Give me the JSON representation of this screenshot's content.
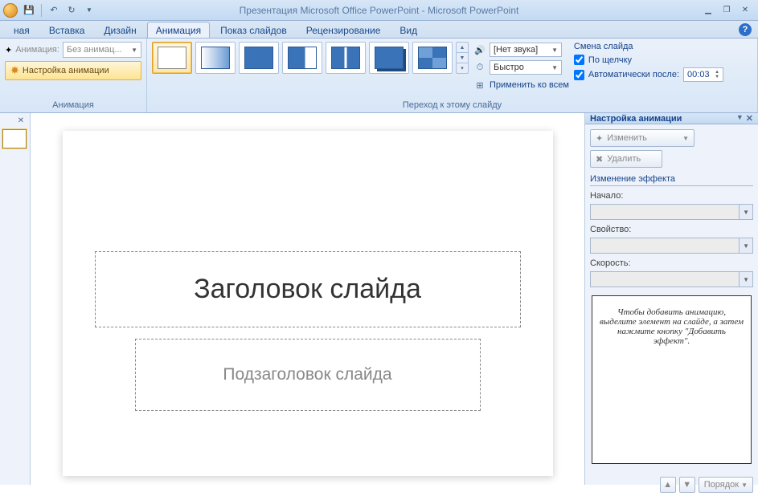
{
  "titlebar": {
    "title": "Презентация Microsoft Office PowerPoint - Microsoft PowerPoint"
  },
  "tabs": {
    "home": "ная",
    "insert": "Вставка",
    "design": "Дизайн",
    "animation": "Анимация",
    "slideshow": "Показ слайдов",
    "review": "Рецензирование",
    "view": "Вид"
  },
  "ribbon": {
    "anim_group": {
      "label": "Анимация",
      "anim_label": "Анимация:",
      "anim_value": "Без анимац...",
      "settings_btn": "Настройка анимации"
    },
    "trans_group": {
      "label": "Переход к этому слайду",
      "sound_label": "[Нет звука]",
      "speed_label": "Быстро",
      "apply_all": "Применить ко всем",
      "advance_title": "Смена слайда",
      "on_click": "По щелчку",
      "auto_after": "Автоматически после:",
      "auto_time": "00:03"
    }
  },
  "slide": {
    "title_placeholder": "Заголовок слайда",
    "subtitle_placeholder": "Подзаголовок слайда"
  },
  "task_pane": {
    "header": "Настройка анимации",
    "change_btn": "Изменить",
    "remove_btn": "Удалить",
    "effect_section": "Изменение эффекта",
    "start_label": "Начало:",
    "property_label": "Свойство:",
    "speed_label": "Скорость:",
    "hint": "Чтобы добавить анимацию, выделите элемент на слайде, а затем нажмите кнопку \"Добавить эффект\".",
    "order_btn": "Порядок"
  }
}
